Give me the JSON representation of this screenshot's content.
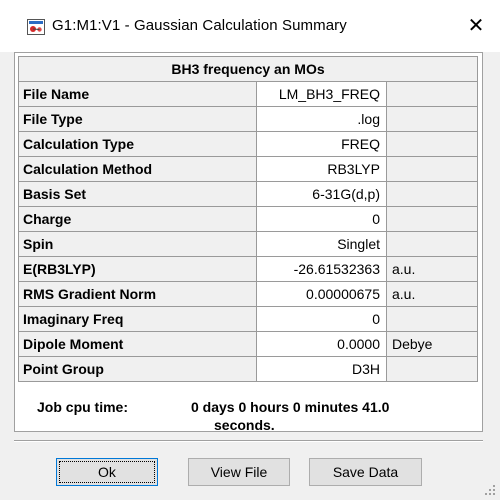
{
  "window": {
    "title": "G1:M1:V1 - Gaussian Calculation Summary",
    "app_icon": "gaussview-app-icon",
    "close_icon": "close-icon"
  },
  "summary": {
    "caption": "BH3 frequency an MOs",
    "rows": [
      {
        "label": "File Name",
        "value": "LM_BH3_FREQ",
        "unit": ""
      },
      {
        "label": "File Type",
        "value": ".log",
        "unit": ""
      },
      {
        "label": "Calculation Type",
        "value": "FREQ",
        "unit": ""
      },
      {
        "label": "Calculation Method",
        "value": "RB3LYP",
        "unit": ""
      },
      {
        "label": "Basis Set",
        "value": "6-31G(d,p)",
        "unit": ""
      },
      {
        "label": "Charge",
        "value": "0",
        "unit": ""
      },
      {
        "label": "Spin",
        "value": "Singlet",
        "unit": ""
      },
      {
        "label": "E(RB3LYP)",
        "value": "-26.61532363",
        "unit": "a.u."
      },
      {
        "label": "RMS Gradient Norm",
        "value": "0.00000675",
        "unit": "a.u."
      },
      {
        "label": "Imaginary Freq",
        "value": "0",
        "unit": ""
      },
      {
        "label": "Dipole Moment",
        "value": "0.0000",
        "unit": "Debye"
      },
      {
        "label": "Point Group",
        "value": "D3H",
        "unit": ""
      }
    ],
    "cpu_time": {
      "label": "Job cpu time:",
      "value_line1": "0 days  0 hours  0 minutes 41.0",
      "value_line2": "seconds."
    }
  },
  "buttons": {
    "ok": "Ok",
    "view_file": "View File",
    "save_data": "Save Data"
  }
}
